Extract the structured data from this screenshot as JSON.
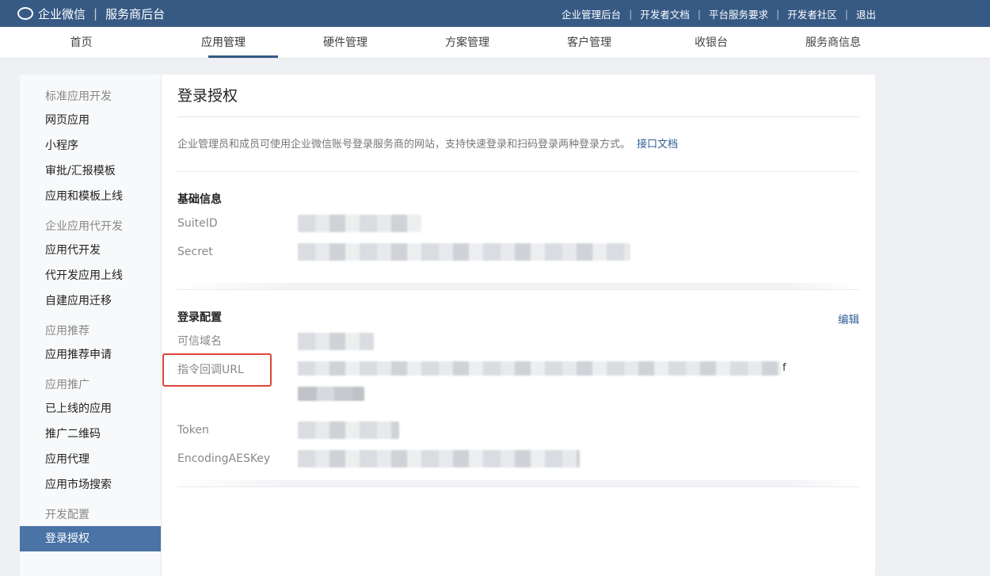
{
  "header": {
    "brand": "企业微信",
    "subtitle": "服务商后台",
    "links": [
      "企业管理后台",
      "开发者文档",
      "平台服务要求",
      "开发者社区",
      "退出"
    ]
  },
  "nav": {
    "tabs": [
      "首页",
      "应用管理",
      "硬件管理",
      "方案管理",
      "客户管理",
      "收银台",
      "服务商信息"
    ],
    "active": "应用管理"
  },
  "sidebar": {
    "groups": [
      {
        "title": "标准应用开发",
        "items": [
          "网页应用",
          "小程序",
          "审批/汇报模板",
          "应用和模板上线"
        ]
      },
      {
        "title": "企业应用代开发",
        "items": [
          "应用代开发",
          "代开发应用上线",
          "自建应用迁移"
        ]
      },
      {
        "title": "应用推荐",
        "items": [
          "应用推荐申请"
        ]
      },
      {
        "title": "应用推广",
        "items": [
          "已上线的应用",
          "推广二维码",
          "应用代理",
          "应用市场搜索"
        ]
      },
      {
        "title": "开发配置",
        "items": [
          "登录授权"
        ]
      }
    ],
    "active_item": "登录授权"
  },
  "main": {
    "title": "登录授权",
    "description": "企业管理员和成员可使用企业微信账号登录服务商的网站，支持快速登录和扫码登录两种登录方式。",
    "doc_link": "接口文档",
    "basic": {
      "title": "基础信息",
      "fields": [
        {
          "label": "SuiteID"
        },
        {
          "label": "Secret"
        }
      ]
    },
    "login": {
      "title": "登录配置",
      "edit": "编辑",
      "fields": [
        {
          "label": "可信域名"
        },
        {
          "label": "指令回调URL",
          "tail": "f"
        },
        {
          "label": "Token"
        },
        {
          "label": "EncodingAESKey"
        }
      ]
    }
  }
}
